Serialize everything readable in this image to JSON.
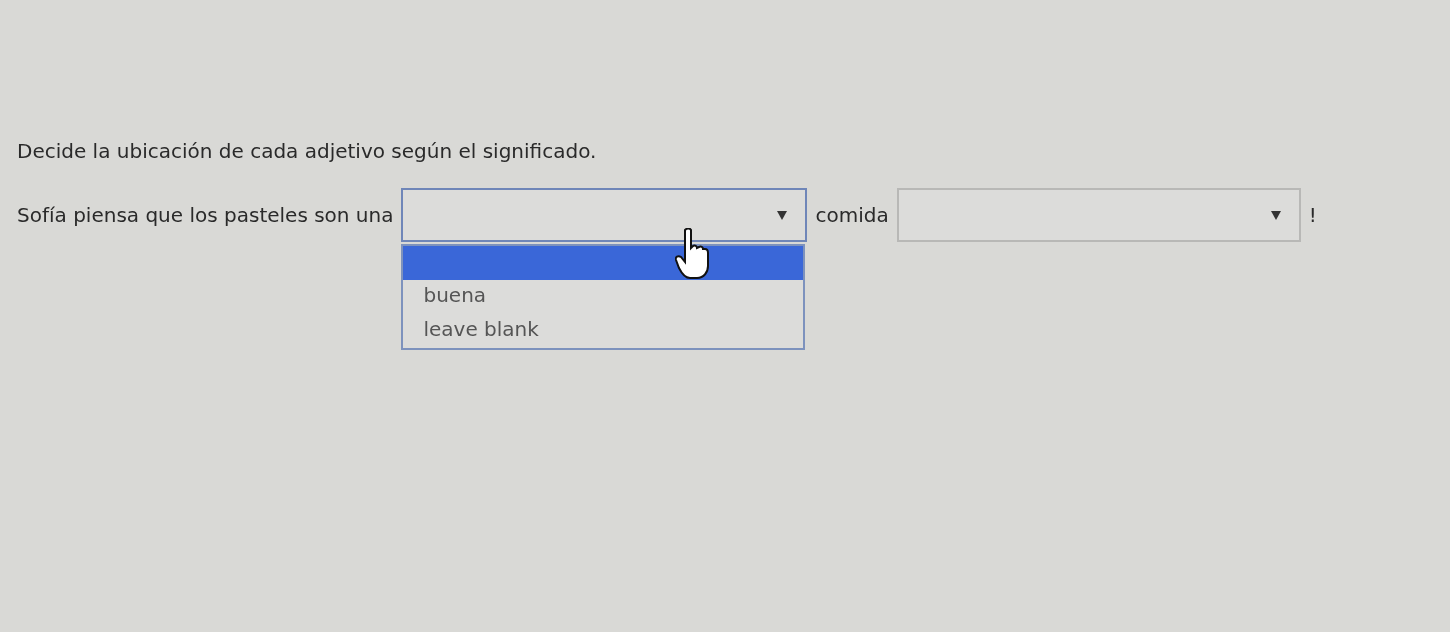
{
  "instruction": "Decide la ubicación de cada adjetivo según el significado.",
  "sentence": [
    {
      "kind": "text",
      "text": "Sofía piensa que los pasteles son una"
    },
    {
      "kind": "select",
      "expanded": true,
      "options": [
        {
          "kind": "blank",
          "selected": true
        },
        {
          "kind": "option",
          "label": "buena",
          "selected": false
        },
        {
          "kind": "option",
          "label": "leave blank",
          "selected": false
        }
      ]
    },
    {
      "kind": "text",
      "text": "comida"
    },
    {
      "kind": "select",
      "expanded": false
    },
    {
      "kind": "text",
      "text": "!"
    }
  ]
}
